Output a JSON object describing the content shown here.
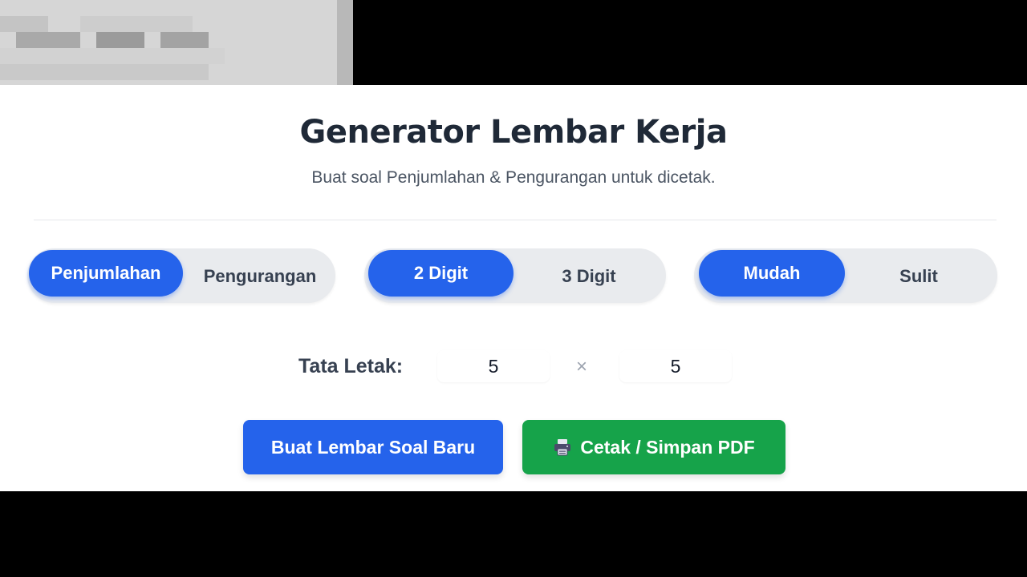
{
  "colors": {
    "accent": "#2563eb",
    "success": "#16a34a",
    "toggle_bg": "#e9ebee",
    "title": "#1f2937"
  },
  "header": {
    "title": "Generator Lembar Kerja",
    "subtitle": "Buat soal Penjumlahan & Pengurangan untuk dicetak."
  },
  "toggles": {
    "operation": {
      "options": [
        "Penjumlahan",
        "Pengurangan"
      ],
      "selected": "Penjumlahan"
    },
    "digits": {
      "options": [
        "2 Digit",
        "3 Digit"
      ],
      "selected": "2 Digit"
    },
    "difficulty": {
      "options": [
        "Mudah",
        "Sulit"
      ],
      "selected": "Mudah"
    }
  },
  "layout": {
    "label": "Tata Letak:",
    "rows": "5",
    "times_symbol": "×",
    "cols": "5"
  },
  "actions": {
    "generate_label": "Buat Lembar Soal Baru",
    "print_label": "Cetak / Simpan PDF",
    "print_icon": "printer-icon"
  }
}
